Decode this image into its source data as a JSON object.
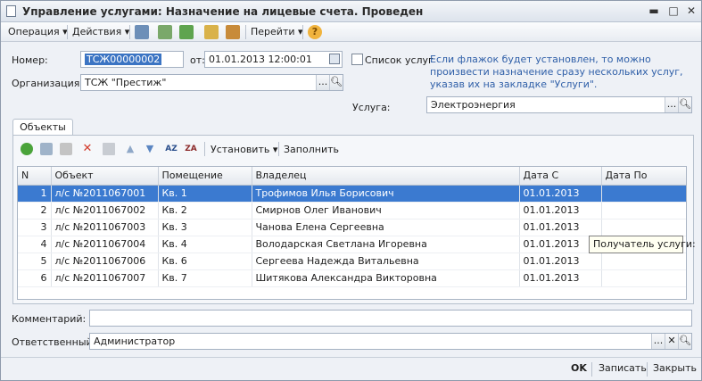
{
  "window": {
    "title": "Управление услугами: Назначение на лицевые счета. Проведен",
    "minimize_glyph": "▬",
    "maximize_glyph": "□",
    "close_glyph": "✕"
  },
  "toolbar": {
    "operation_label": "Операция",
    "actions_label": "Действия",
    "goto_label": "Перейти",
    "dropdown_glyph": "▾",
    "help_glyph": "?"
  },
  "form": {
    "number_label": "Номер:",
    "number_value": "ТСЖ00000002",
    "date_label": "от:",
    "date_value": "01.01.2013 12:00:01",
    "org_label": "Организация:",
    "org_value": "ТСЖ \"Престиж\"",
    "service_list_label": "Список услуг",
    "hint_text": "Если флажок будет установлен, то можно произвести назначение сразу нескольких услуг, указав их на закладке \"Услуги\".",
    "service_label": "Услуга:",
    "service_value": "Электроэнергия",
    "comment_label": "Комментарий:",
    "comment_value": "",
    "responsible_label": "Ответственный:",
    "responsible_value": "Администратор",
    "ellipsis_glyph": "...",
    "clear_glyph": "✕"
  },
  "tabs": {
    "objects_label": "Объекты"
  },
  "objects_toolbar": {
    "set_label": "Установить",
    "fill_label": "Заполнить",
    "dropdown_glyph": "▾"
  },
  "table": {
    "columns": [
      "N",
      "Объект",
      "Помещение",
      "Владелец",
      "Дата С",
      "Дата По"
    ],
    "rows": [
      {
        "n": "1",
        "object": "л/с №2011067001",
        "room": "Кв. 1",
        "owner": "Трофимов Илья Борисович",
        "date_from": "01.01.2013",
        "date_to": ""
      },
      {
        "n": "2",
        "object": "л/с №2011067002",
        "room": "Кв. 2",
        "owner": "Смирнов Олег Иванович",
        "date_from": "01.01.2013",
        "date_to": ""
      },
      {
        "n": "3",
        "object": "л/с №2011067003",
        "room": "Кв. 3",
        "owner": "Чанова Елена Сергеевна",
        "date_from": "01.01.2013",
        "date_to": ""
      },
      {
        "n": "4",
        "object": "л/с №2011067004",
        "room": "Кв. 4",
        "owner": "Володарская Светлана Игоревна",
        "date_from": "01.01.2013",
        "date_to": ""
      },
      {
        "n": "5",
        "object": "л/с №2011067006",
        "room": "Кв. 6",
        "owner": "Сергеева Надежда Витальевна",
        "date_from": "01.01.2013",
        "date_to": ""
      },
      {
        "n": "6",
        "object": "л/с №2011067007",
        "room": "Кв. 7",
        "owner": "Шитякова Александра Викторовна",
        "date_from": "01.01.2013",
        "date_to": ""
      }
    ]
  },
  "tooltip": {
    "text": "Получатель услуги:"
  },
  "footer": {
    "ok_label": "OK",
    "save_label": "Записать",
    "close_label": "Закрыть"
  },
  "colors": {
    "selection": "#3b7ad0",
    "hint_text": "#2f5fa8"
  }
}
